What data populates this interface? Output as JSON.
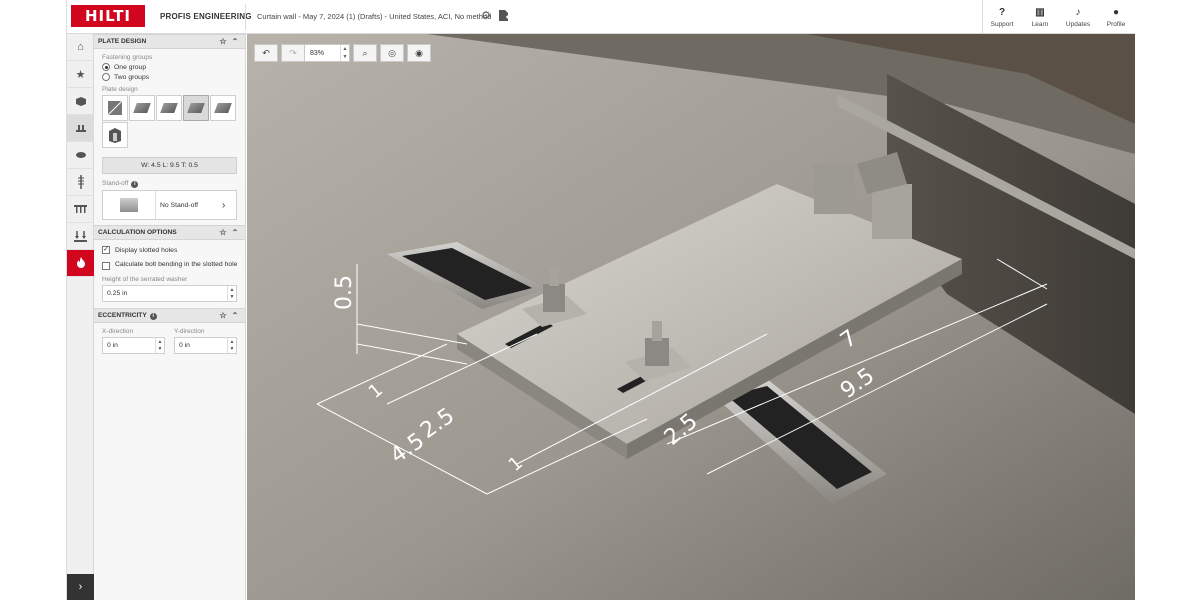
{
  "header": {
    "logo_text": "HILTI",
    "product_name": "PROFIS ENGINEERING",
    "project_title": "Curtain wall - May 7, 2024 (1) (Drafts) - United States, ACI, No method",
    "right_buttons": [
      {
        "label": "Support",
        "icon": "?"
      },
      {
        "label": "Learn",
        "icon": "▥"
      },
      {
        "label": "Updates",
        "icon": "♪"
      },
      {
        "label": "Profile",
        "icon": "●"
      }
    ]
  },
  "rail": {
    "expand_icon": "›"
  },
  "plate_design": {
    "title": "PLATE DESIGN",
    "fastening_label": "Fastening groups",
    "options": [
      "One group",
      "Two groups"
    ],
    "selected_option": 0,
    "plate_design_label": "Plate design",
    "dims_text": "W: 4.5 L: 9.5 T: 0.5",
    "standoff_label": "Stand-off",
    "standoff_value": "No Stand-off"
  },
  "calculation_options": {
    "title": "CALCULATION OPTIONS",
    "display_slotted": "Display slotted holes",
    "display_slotted_checked": true,
    "calc_bolt": "Calculate bolt bending in the slotted hole",
    "calc_bolt_checked": false,
    "washer_label": "Height of the serrated washer",
    "washer_value": "0.25 in"
  },
  "eccentricity": {
    "title": "ECCENTRICITY",
    "x_label": "X-direction",
    "y_label": "Y-direction",
    "x_value": "0 in",
    "y_value": "0 in"
  },
  "viewport": {
    "zoom": "83%",
    "dimensions": {
      "thickness": "0.5",
      "edge1": "1",
      "pitch1": "2.5",
      "width": "4.5",
      "edge2": "1",
      "pitch2": "2.5",
      "gap": "7",
      "length": "9.5"
    }
  },
  "colors": {
    "brand": "#d2051e"
  }
}
